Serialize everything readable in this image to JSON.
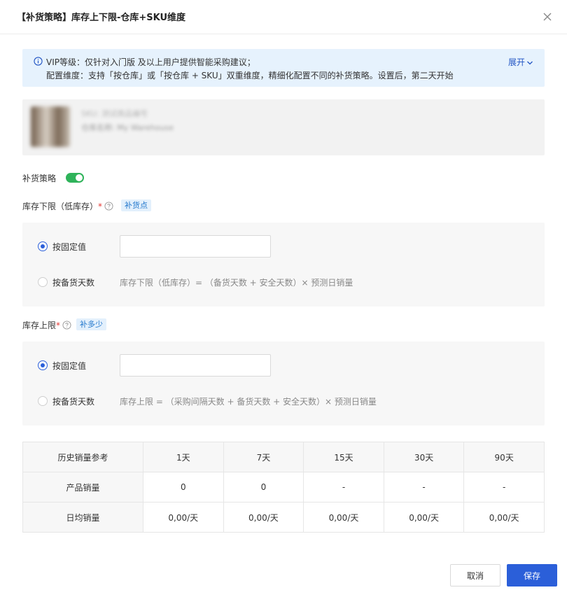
{
  "modal": {
    "title": "【补货策略】库存上下限-仓库+SKU维度"
  },
  "notice": {
    "line1": "VIP等级：仅针对入门版 及以上用户提供智能采购建议；",
    "line2": "配置维度：支持「按仓库」或「按仓库 + SKU」双重维度，精细化配置不同的补货策略。设置后，第二天开始",
    "expand_label": "展开",
    "accent": "#2255c4",
    "background": "#e6f2fd"
  },
  "product": {
    "line1": "SKU: 测试商品编号",
    "line2": "仓库名称: My Warehouse"
  },
  "strategy": {
    "label": "补货策略",
    "enabled": true,
    "toggle_color": "#2fb35a"
  },
  "lower_limit": {
    "label": "库存下限（低库存）",
    "required_mark": "*",
    "tag": "补货点",
    "options": [
      {
        "label": "按固定值",
        "checked": true
      },
      {
        "label": "按备货天数",
        "checked": false
      }
    ],
    "input_value": "",
    "formula": "库存下限（低库存）= （备货天数 + 安全天数）× 预测日销量"
  },
  "upper_limit": {
    "label": "库存上限",
    "required_mark": "*",
    "tag": "补多少",
    "options": [
      {
        "label": "按固定值",
        "checked": true
      },
      {
        "label": "按备货天数",
        "checked": false
      }
    ],
    "input_value": "",
    "formula": "库存上限 = （采购间隔天数 + 备货天数 + 安全天数）× 预测日销量"
  },
  "history_table": {
    "header": [
      "历史销量参考",
      "1天",
      "7天",
      "15天",
      "30天",
      "90天"
    ],
    "rows": [
      [
        "产品销量",
        "0",
        "0",
        "-",
        "-",
        "-"
      ],
      [
        "日均销量",
        "0,00/天",
        "0,00/天",
        "0,00/天",
        "0,00/天",
        "0,00/天"
      ]
    ]
  },
  "footer": {
    "cancel_label": "取消",
    "save_label": "保存",
    "primary_color": "#2b5fd9"
  }
}
